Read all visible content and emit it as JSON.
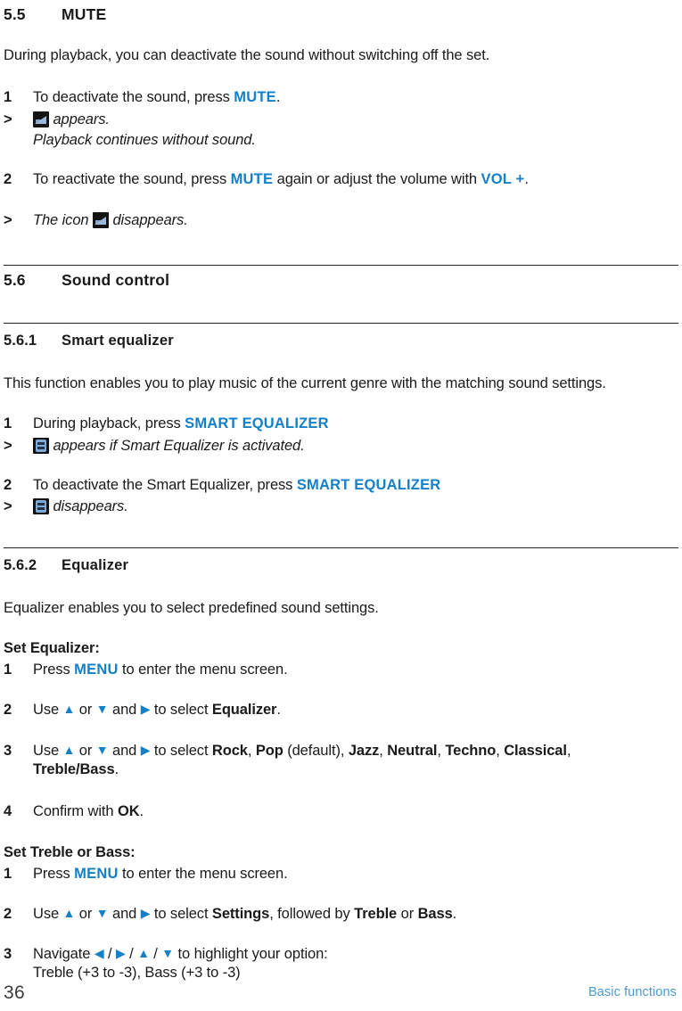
{
  "document": {
    "page_number": "36",
    "footer_section": "Basic functions",
    "accent_blue": "#1380C8",
    "footer_blue": "#4A9AD4"
  },
  "sections": {
    "mute": {
      "number": "5.5",
      "title": "MUTE",
      "intro": "During playback, you can deactivate the sound without switching off the set.",
      "steps": [
        {
          "marker": "1",
          "text_before": "To deactivate the sound, press ",
          "key": "MUTE",
          "text_after": "."
        },
        {
          "marker": ">",
          "icon": "mute-display-icon",
          "text_after": "appears.",
          "note": "Playback continues without sound."
        },
        {
          "marker": "2",
          "text_before": "To reactivate the sound, press ",
          "key": "MUTE",
          "text_mid": " again or adjust the volume with ",
          "key2": "VOL +",
          "text_after": "."
        },
        {
          "marker": ">",
          "text_before": "The icon ",
          "icon": "mute-display-icon",
          "text_after": "disappears."
        }
      ]
    },
    "sound_control": {
      "number": "5.6",
      "title": "Sound control"
    },
    "smart_equalizer": {
      "number": "5.6.1",
      "title": "Smart equalizer",
      "intro": "This function enables you to play music of the current genre with the matching sound settings.",
      "steps": [
        {
          "marker": "1",
          "text_before": "During playback, press ",
          "key": "SMART EQUALIZER"
        },
        {
          "marker": ">",
          "icon": "smart-eq-display-icon",
          "text_after": "appears if Smart Equalizer is activated."
        },
        {
          "marker": "2",
          "text_before": "To deactivate the Smart Equalizer, press ",
          "key": "SMART EQUALIZER"
        },
        {
          "marker": ">",
          "icon": "smart-eq-display-icon",
          "text_after": "disappears."
        }
      ]
    },
    "equalizer": {
      "number": "5.6.2",
      "title": "Equalizer",
      "intro": "Equalizer enables you to select predefined sound settings.",
      "set_equalizer": {
        "heading": "Set Equalizer:",
        "step1": {
          "marker": "1",
          "text_before": "Press ",
          "key": "MENU",
          "text_after": " to enter the menu screen."
        },
        "step2": {
          "marker": "2",
          "lead": "Use ",
          "arrow_up": "▲",
          "mid_or": " or ",
          "arrow_down": "▼",
          "mid_and": " and ",
          "arrow_right": "▶",
          "tail": " to select ",
          "target": "Equalizer",
          "period": "."
        },
        "step3": {
          "marker": "3",
          "lead": "Use ",
          "arrow_up": "▲",
          "mid_or": " or ",
          "arrow_down": "▼",
          "mid_and": " and ",
          "arrow_right": "▶",
          "tail": " to select ",
          "options": [
            "Rock",
            "Pop",
            "Jazz",
            "Neutral",
            "Techno",
            "Classical",
            "Treble/Bass"
          ],
          "default_note": "(default)",
          "period": "."
        },
        "step4": {
          "marker": "4",
          "text_before": "Confirm with ",
          "key": "OK",
          "text_after": "."
        }
      },
      "set_treble_bass": {
        "heading": "Set Treble or Bass:",
        "step1": {
          "marker": "1",
          "text_before": "Press ",
          "key": "MENU",
          "text_after": " to enter the menu screen."
        },
        "step2": {
          "marker": "2",
          "lead": "Use ",
          "arrow_up": "▲",
          "mid_or": " or ",
          "arrow_down": "▼",
          "mid_and": " and ",
          "arrow_right": "▶",
          "tail": " to select ",
          "target": "Settings",
          "mid2": ", followed by ",
          "target2": "Treble",
          "mid3": " or ",
          "target3": "Bass",
          "period": "."
        },
        "step3": {
          "marker": "3",
          "lead": "Navigate ",
          "arrow_left": "◀",
          "sep1": " / ",
          "arrow_right": "▶",
          "sep2": " / ",
          "arrow_up": "▲",
          "sep3": " / ",
          "arrow_down": "▼",
          "tail": " to highlight your option:",
          "line2": "Treble (+3 to -3), Bass (+3 to -3)"
        }
      }
    }
  }
}
